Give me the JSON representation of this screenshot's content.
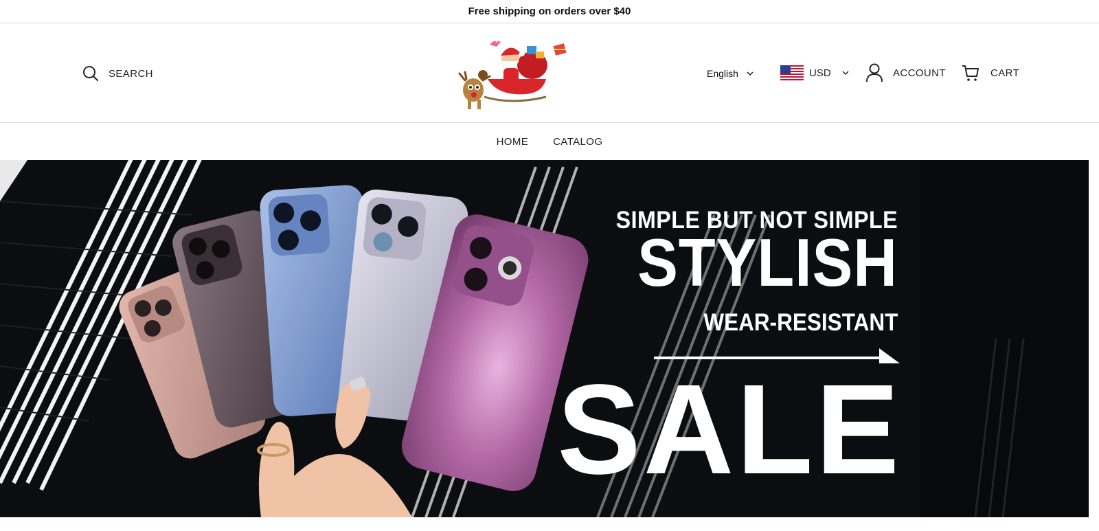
{
  "announcement": {
    "text": "Free shipping on orders over $40"
  },
  "header": {
    "search_label": "SEARCH",
    "language": "English",
    "currency": "USD",
    "account_label": "ACCOUNT",
    "cart_label": "CART"
  },
  "nav": {
    "items": [
      {
        "label": "HOME"
      },
      {
        "label": "CATALOG"
      }
    ]
  },
  "hero": {
    "line1": "SIMPLE BUT NOT SIMPLE",
    "line2": "STYLISH",
    "line3": "WEAR-RESISTANT",
    "line4": "SALE",
    "case_colors": [
      "#c79a92",
      "#6a5a60",
      "#7f9ccd",
      "#c8c6d6",
      "#b56aa8"
    ]
  },
  "icons": {
    "search": "search-icon",
    "dropdown": "chevron-down-icon",
    "flag": "us-flag-icon",
    "account": "user-icon",
    "cart": "cart-icon"
  }
}
